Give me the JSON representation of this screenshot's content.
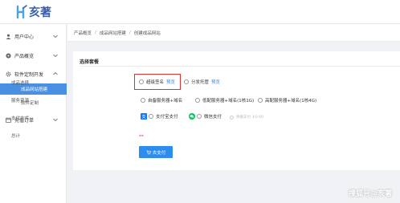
{
  "brand": {
    "logo_text": "亥著"
  },
  "sidebar": {
    "items": [
      {
        "label": "用户中心",
        "icon": "user-icon"
      },
      {
        "label": "产品概览",
        "icon": "tag-icon"
      },
      {
        "label": "软件定制开发",
        "icon": "gear-icon"
      },
      {
        "label": "充值订单",
        "icon": "calendar-icon"
      }
    ],
    "sub_items": [
      {
        "label": "成品网站搭建",
        "active": true
      },
      {
        "label": "软件定制",
        "active": false
      }
    ]
  },
  "breadcrumb": [
    "产品概览",
    "成品网站搭建",
    "创建成品网站"
  ],
  "breadcrumb_sep": "/",
  "form": {
    "section_title": "选择套餐",
    "product_label": "成品选择",
    "product_options": [
      {
        "label": "超级签名",
        "link": "预览"
      },
      {
        "label": "分发托管",
        "link": "预览"
      }
    ],
    "server_label": "服务资源",
    "server_options": [
      "自备服务器+域名",
      "低配服务器+域名(1核1G)",
      "高配服务器+域名(1核4G)"
    ],
    "pay_label": "支付方式",
    "pay_options": [
      {
        "label": "支付宝支付",
        "icon": "alipay-icon",
        "badge": "支"
      },
      {
        "label": "微信支付",
        "icon": "wechat-icon"
      },
      {
        "label": "余额支付 ￥0.00",
        "icon": "wallet-icon",
        "disabled": true
      }
    ],
    "total_label": "总计",
    "total_value": "--",
    "submit_label": "去支付"
  },
  "watermark": "搜狐号@亥著",
  "colors": {
    "accent": "#2d8cf0",
    "sidebar_active": "#4a90e2",
    "alert": "#e0302f",
    "alipay": "#1677ff",
    "wechat": "#07c160"
  }
}
